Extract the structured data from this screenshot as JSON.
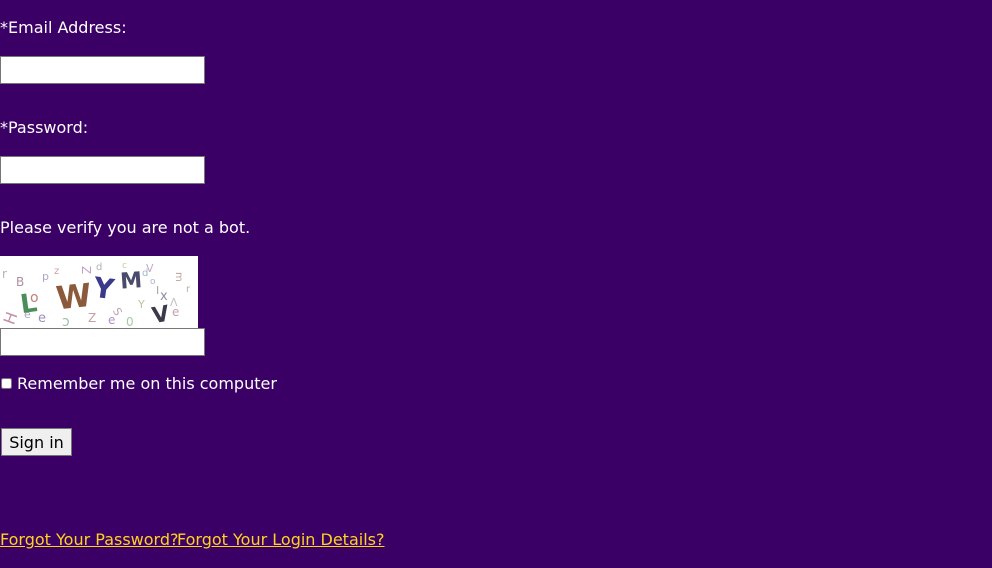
{
  "form": {
    "email_label": "*Email Address:",
    "email_value": "",
    "password_label": "*Password:",
    "password_value": "",
    "bot_check_label": "Please verify you are not a bot.",
    "captcha_image": "WYM",
    "captcha_value": "",
    "remember_label": "Remember me on this computer",
    "remember_checked": false,
    "sign_in_label": "Sign in"
  },
  "links": {
    "forgot_password": "Forgot Your Password?",
    "forgot_login": "Forgot Your Login Details?"
  },
  "colors": {
    "background": "#3b0066",
    "text": "#ffffff",
    "link": "#ffd21f"
  }
}
